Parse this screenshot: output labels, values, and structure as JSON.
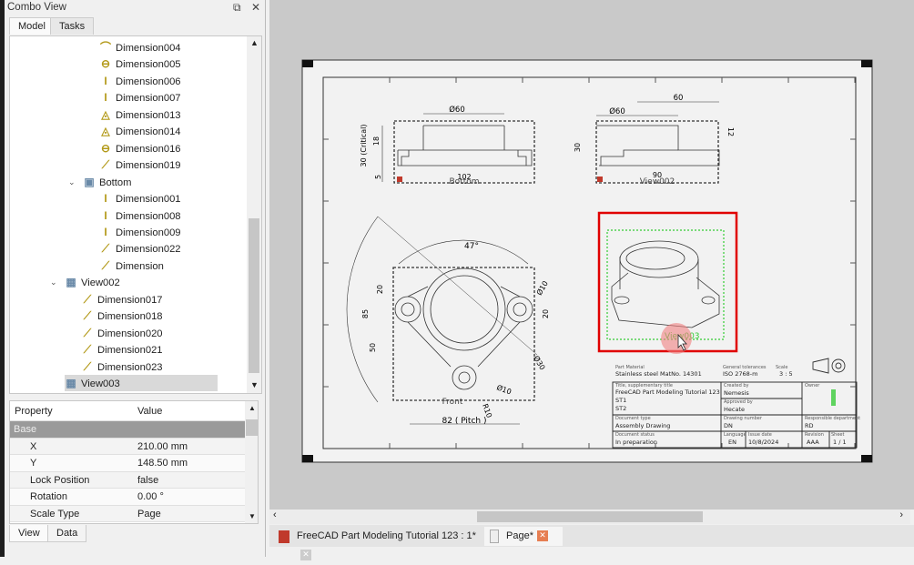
{
  "combo": {
    "title": "Combo View",
    "tabs": [
      "Model",
      "Tasks"
    ],
    "float_icon": "float-icon",
    "close_icon": "close-icon"
  },
  "tree": {
    "items": [
      {
        "label": "Dimension004",
        "icon": "angle-dimension-icon",
        "level": 3
      },
      {
        "label": "Dimension005",
        "icon": "diameter-dimension-icon",
        "level": 3
      },
      {
        "label": "Dimension006",
        "icon": "vertical-dimension-icon",
        "level": 3
      },
      {
        "label": "Dimension007",
        "icon": "vertical-dimension-icon",
        "level": 3
      },
      {
        "label": "Dimension013",
        "icon": "radius-dimension-icon",
        "level": 3
      },
      {
        "label": "Dimension014",
        "icon": "radius-dimension-icon",
        "level": 3
      },
      {
        "label": "Dimension016",
        "icon": "diameter-dimension-icon",
        "level": 3
      },
      {
        "label": "Dimension019",
        "icon": "length-dimension-icon",
        "level": 3
      },
      {
        "label": "Bottom",
        "icon": "projection-view-icon",
        "level": 2,
        "expanded": true
      },
      {
        "label": "Dimension001",
        "icon": "vertical-dimension-icon",
        "level": 3
      },
      {
        "label": "Dimension008",
        "icon": "vertical-dimension-icon",
        "level": 3
      },
      {
        "label": "Dimension009",
        "icon": "vertical-dimension-icon",
        "level": 3
      },
      {
        "label": "Dimension022",
        "icon": "length-dimension-icon",
        "level": 3
      },
      {
        "label": "Dimension",
        "icon": "length-dimension-icon",
        "level": 3
      },
      {
        "label": "View002",
        "icon": "part-view-icon",
        "level": 1,
        "expanded": true
      },
      {
        "label": "Dimension017",
        "icon": "length-dimension-icon",
        "level": 2
      },
      {
        "label": "Dimension018",
        "icon": "length-dimension-icon",
        "level": 2
      },
      {
        "label": "Dimension020",
        "icon": "length-dimension-icon",
        "level": 2
      },
      {
        "label": "Dimension021",
        "icon": "length-dimension-icon",
        "level": 2
      },
      {
        "label": "Dimension023",
        "icon": "length-dimension-icon",
        "level": 2
      },
      {
        "label": "View003",
        "icon": "part-view-icon",
        "level": 1,
        "selected": true
      }
    ]
  },
  "properties": {
    "headers": [
      "Property",
      "Value"
    ],
    "group": "Base",
    "rows": [
      {
        "name": "X",
        "value": "210.00 mm"
      },
      {
        "name": "Y",
        "value": "148.50 mm"
      },
      {
        "name": "Lock Position",
        "value": "false"
      },
      {
        "name": "Rotation",
        "value": "0.00 °"
      },
      {
        "name": "Scale Type",
        "value": "Page"
      }
    ]
  },
  "bottom_tabs": [
    "View",
    "Data"
  ],
  "doc_tabs": [
    {
      "label": "FreeCAD Part Modeling Tutorial 123 : 1*",
      "active": false
    },
    {
      "label": "Page*",
      "active": true
    }
  ],
  "drawing": {
    "views": {
      "bottom": "Bottom",
      "view002": "View002",
      "front": "Front",
      "view003": "View003"
    },
    "dims": {
      "b_dia": "Ø60",
      "b_18": "18",
      "b_30": "30 (Critical)",
      "b_5": "5",
      "b_102": "102",
      "v_60": "60",
      "v_dia": "Ø60",
      "v_30": "30",
      "v_12": "12",
      "v_90": "90",
      "f_47": "47°",
      "f_20a": "20",
      "f_d10": "Ø10",
      "f_20b": "20",
      "f_85": "85",
      "f_50": "50",
      "f_d30": "Ø30",
      "f_d10b": "Ø10",
      "f_r10": "R10",
      "f_pitch": "82 ( Pitch )"
    },
    "title_block": {
      "part_material_label": "Part Material",
      "part_material": "Stainless steel MatNo. 14301",
      "tolerances_label": "General tolerances",
      "tolerances": "ISO 2768-m",
      "scale_label": "Scale",
      "scale": "3 : 5",
      "title_label": "Title, supplementary title",
      "title": "FreeCAD Part Modeling Tutorial 123",
      "sub1": "ST1",
      "sub2": "ST2",
      "created_label": "Created by",
      "created": "Nemesis",
      "approved_label": "Approved by",
      "approved": "Hecate",
      "owner_label": "Owner",
      "doctype_label": "Document type",
      "doctype": "Assembly Drawing",
      "drawno_label": "Drawing number",
      "drawno": "DN",
      "dept_label": "Responsible department",
      "dept": "RD",
      "status_label": "Document status",
      "status": "In preparation",
      "lang_label": "Language",
      "lang": "EN",
      "date_label": "Issue date",
      "date": "10/8/2024",
      "rev_label": "Revision",
      "rev": "AAA",
      "sheet_label": "Sheet",
      "sheet": "1 / 1"
    }
  },
  "colors": {
    "selection_box": "#e00000",
    "selected_view": "#33cc33",
    "editable_field": "#5fd35f",
    "dimension_icon": "#b39a1a"
  }
}
